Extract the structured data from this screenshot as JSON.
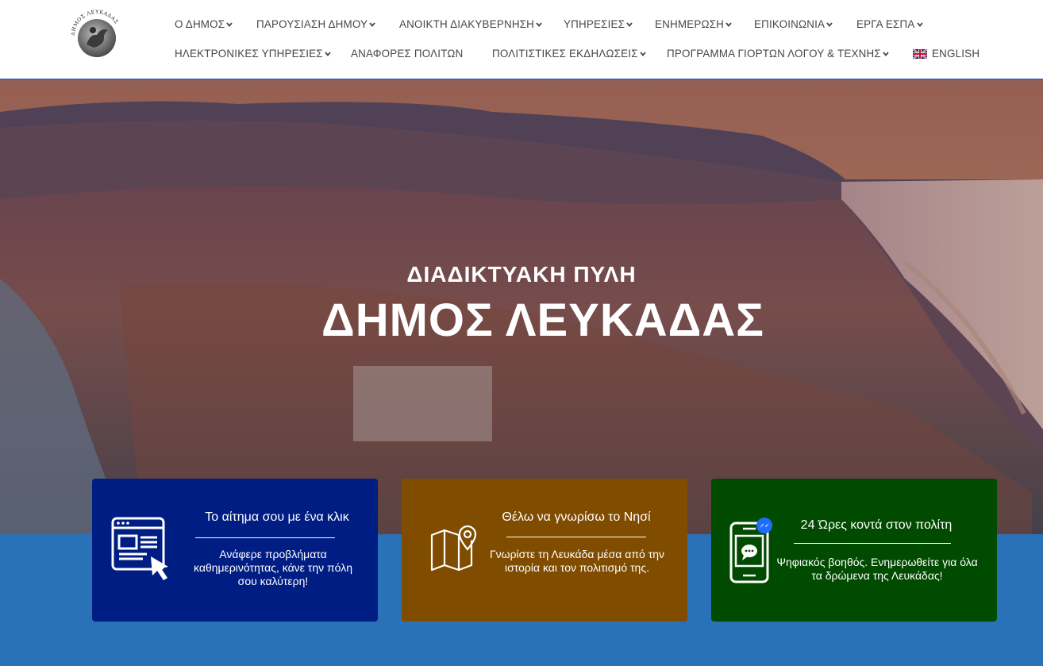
{
  "logo": {
    "text": "ΔΗΜΟΣ ΛΕΥΚΑΔΑΣ"
  },
  "nav": {
    "row1": [
      {
        "label": "Ο ΔΗΜΟΣ",
        "has_caret": true
      },
      {
        "label": "ΠΑΡΟΥΣΙΑΣΗ ΔΗΜΟΥ",
        "has_caret": true
      },
      {
        "label": "ΑΝΟΙΚΤΗ ΔΙΑΚΥΒΕΡΝΗΣΗ",
        "has_caret": true
      },
      {
        "label": "ΥΠΗΡΕΣΙΕΣ",
        "has_caret": true
      },
      {
        "label": "ΕΝΗΜΕΡΩΣΗ",
        "has_caret": true
      },
      {
        "label": "ΕΠΙΚΟΙΝΩΝΙΑ",
        "has_caret": true
      },
      {
        "label": "ΕΡΓΑ ΕΣΠΑ",
        "has_caret": true
      }
    ],
    "row2": [
      {
        "label": "ΗΛΕΚΤΡΟΝΙΚΕΣ ΥΠΗΡΕΣΙΕΣ",
        "has_caret": true
      },
      {
        "label": "ΑΝΑΦΟΡΕΣ ΠΟΛΙΤΩΝ",
        "has_caret": false
      },
      {
        "label": "ΠΟΛΙΤΙΣΤΙΚΕΣ ΕΚΔΗΛΩΣΕΙΣ",
        "has_caret": true
      },
      {
        "label": "ΠΡΟΓΡΑΜΜΑ ΓΙΟΡΤΩΝ ΛΟΓΟΥ & ΤΕΧΝΗΣ",
        "has_caret": true
      },
      {
        "label": "ENGLISH",
        "has_caret": false,
        "icon": "uk-flag-icon"
      }
    ]
  },
  "hero": {
    "subtitle": "ΔΙΑΔΙΚΤΥΑΚΗ ΠΥΛΗ",
    "title": "ΔΗΜΟΣ ΛΕΥΚΑΔΑΣ"
  },
  "cards": [
    {
      "title": "Το αίτημα σου με ένα κλικ",
      "description": "Ανάφερε προβλήματα καθημερινότητας, κάνε την πόλη σου καλύτερη!",
      "icon": "browser-form-click-icon",
      "color": "#001d83"
    },
    {
      "title": "Θέλω να γνωρίσω το Νησί",
      "description": "Γνωρίστε τη Λευκάδα μέσα από την ιστορία και τον πολιτισμό της.",
      "icon": "map-pin-icon",
      "color": "#7f4c00"
    },
    {
      "title": "24 Ώρες κοντά στον πολίτη",
      "description": "Ψηφιακός βοηθός. Ενημερωθείτε για όλα τα δρώμενα της Λευκάδας!",
      "icon": "phone-messenger-chat-icon",
      "color": "#004b00"
    }
  ],
  "colors": {
    "footer_band": "#2a72b8",
    "nav_text": "#474747"
  }
}
